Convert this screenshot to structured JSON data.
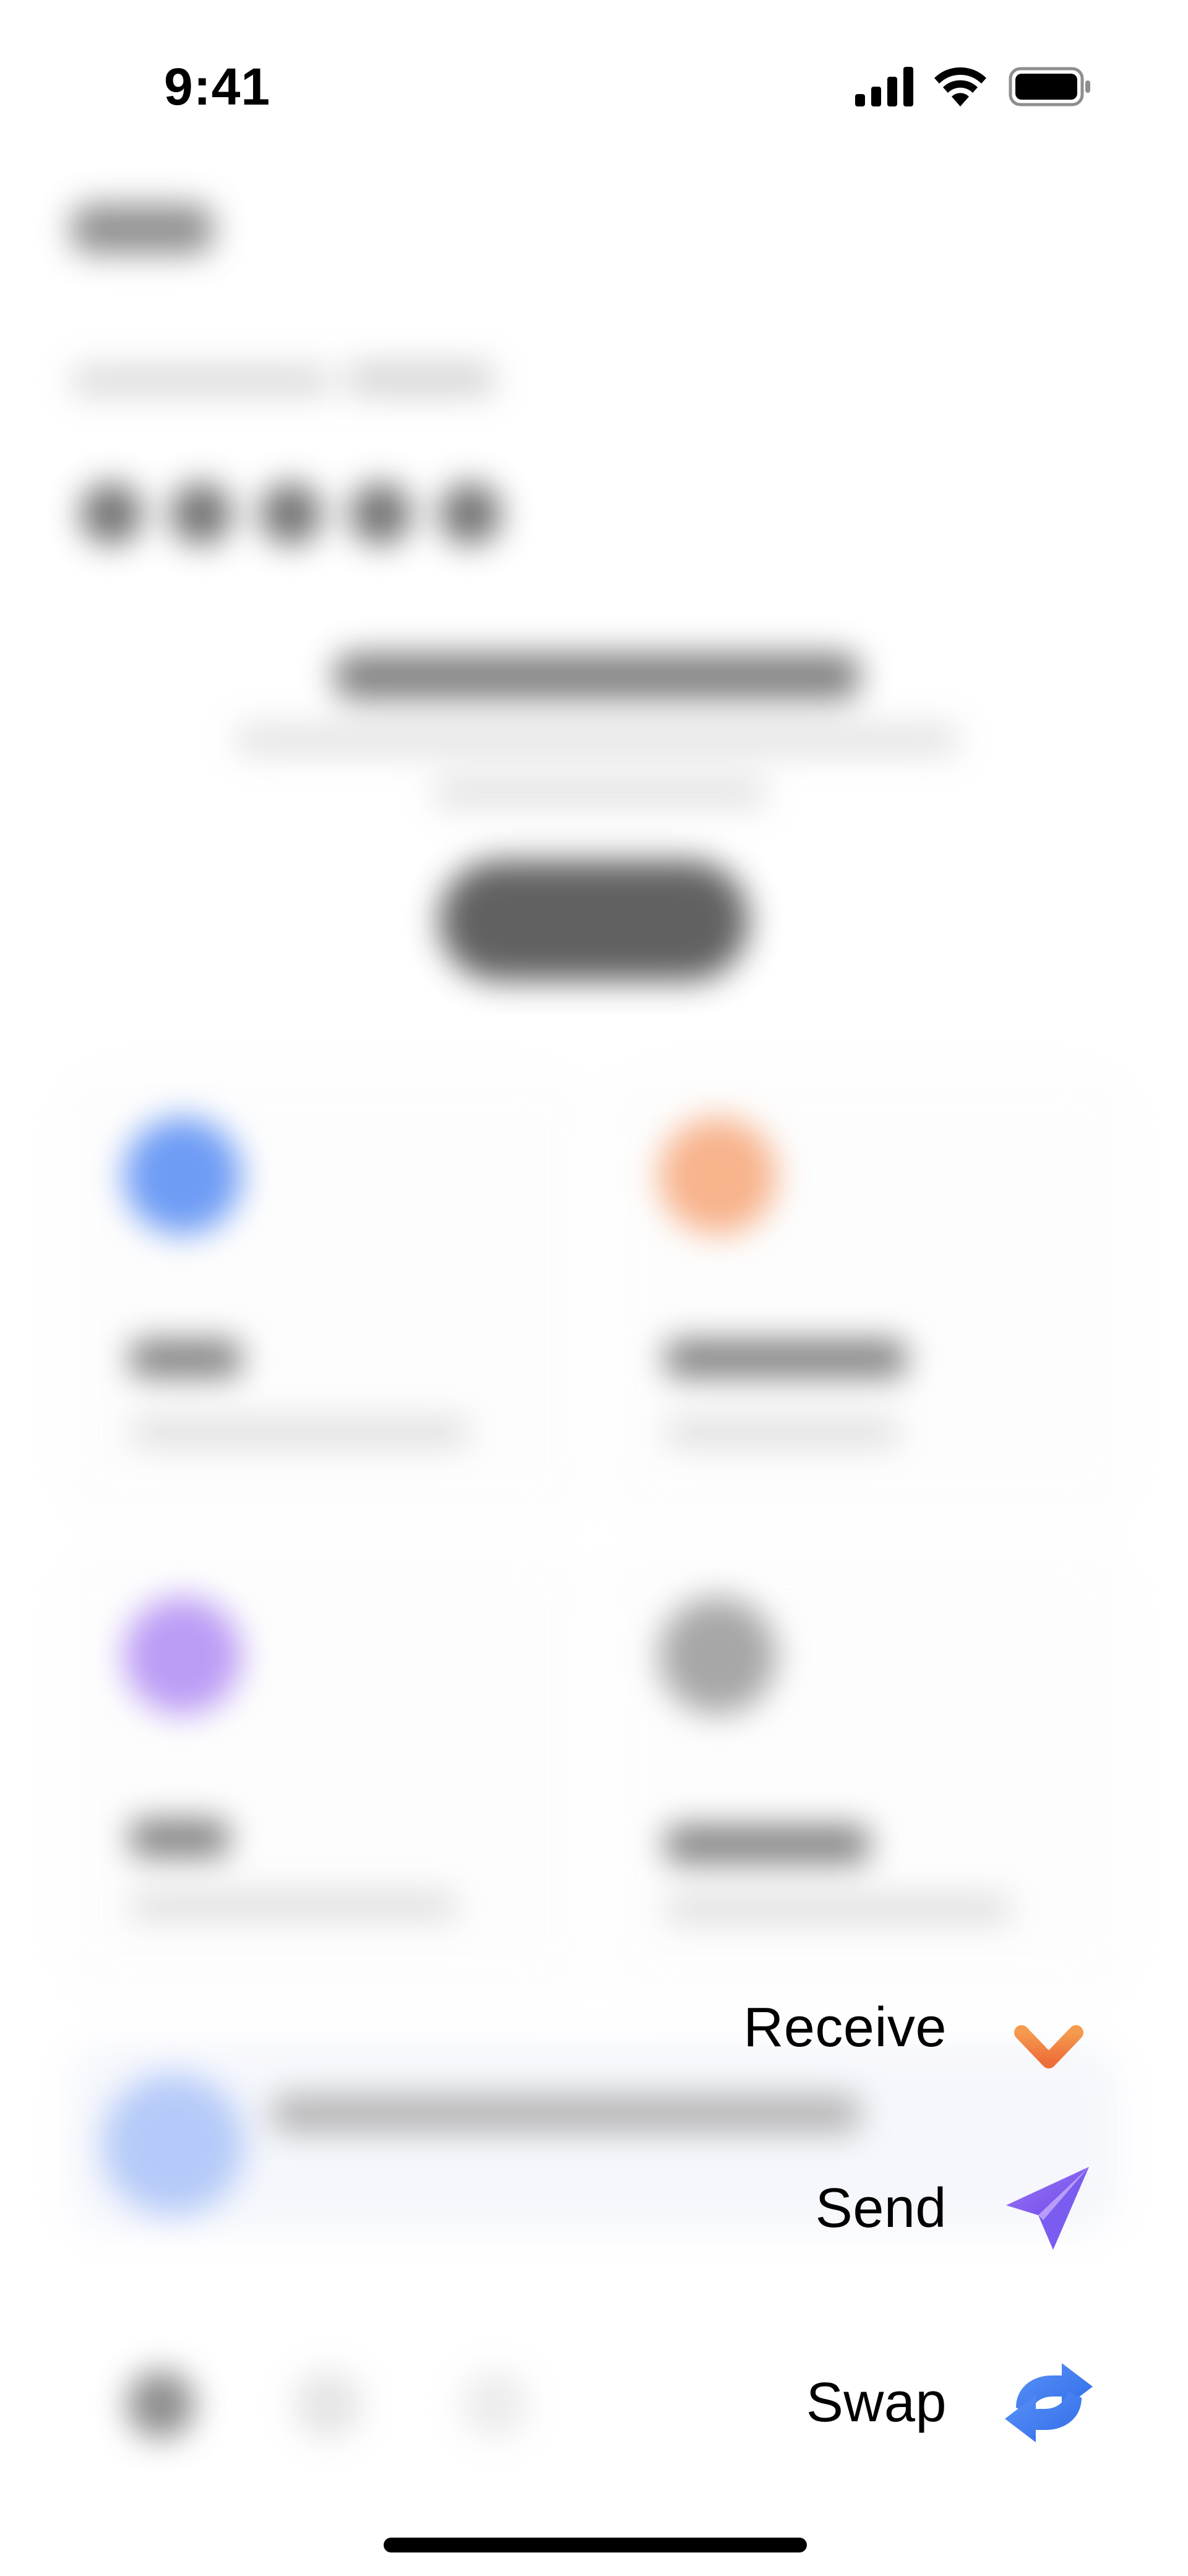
{
  "status_bar": {
    "time": "9:41",
    "icons": [
      "cellular-signal-icon",
      "wifi-icon",
      "battery-icon"
    ]
  },
  "action_menu": {
    "items": [
      {
        "label": "Receive",
        "icon": "arrow-down-icon",
        "color": "#F07A3A"
      },
      {
        "label": "Send",
        "icon": "paper-plane-icon",
        "color": "#7B5CF0"
      },
      {
        "label": "Swap",
        "icon": "swap-arrows-icon",
        "color": "#3E7BF2"
      }
    ]
  },
  "background": {
    "state": "blurred",
    "accent_colors": [
      "#3E7BF2",
      "#F07A3A",
      "#9B6BF0",
      "#8A8A8A"
    ]
  }
}
